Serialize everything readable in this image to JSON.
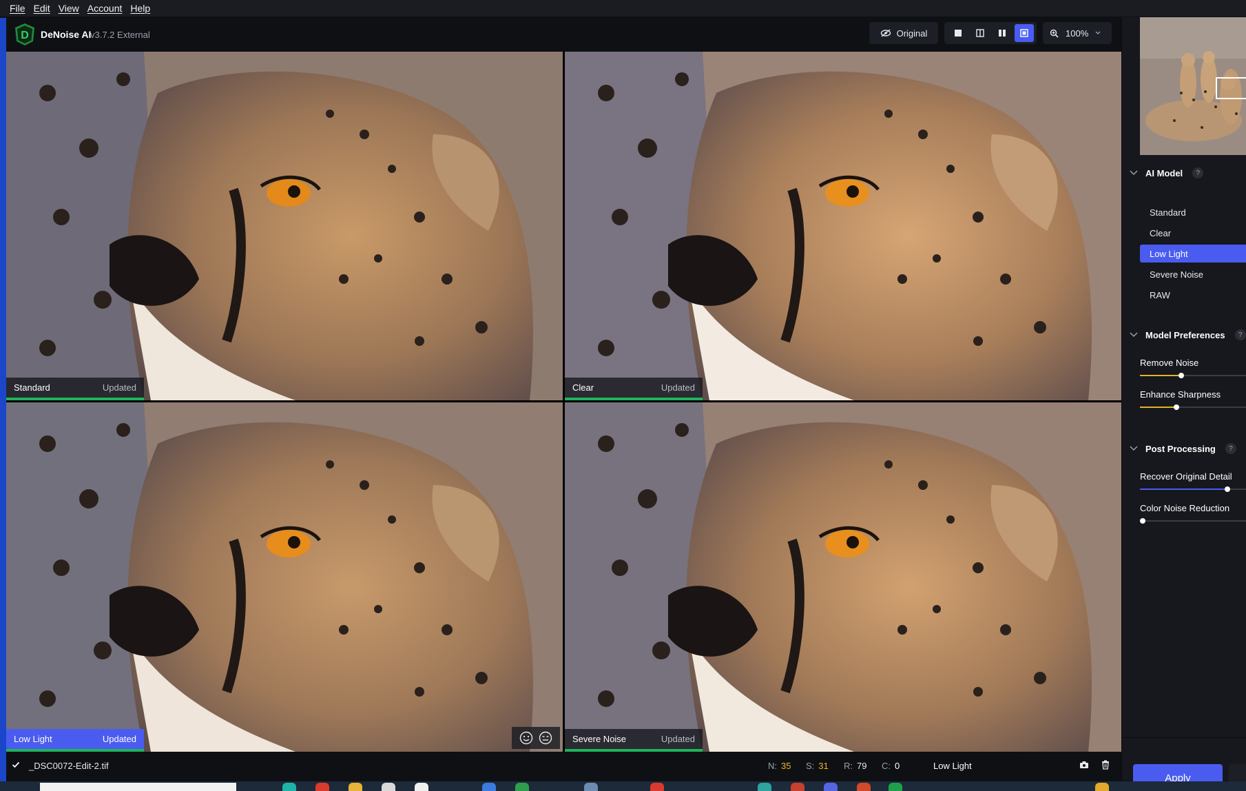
{
  "menu": {
    "file": "File",
    "edit": "Edit",
    "view": "View",
    "account": "Account",
    "help": "Help"
  },
  "header": {
    "app_name": "DeNoise AI",
    "version": "v3.7.2 External",
    "original_label": "Original",
    "zoom_value": "100%"
  },
  "panels": [
    {
      "name": "Standard",
      "status": "Updated"
    },
    {
      "name": "Clear",
      "status": "Updated"
    },
    {
      "name": "Low Light",
      "status": "Updated"
    },
    {
      "name": "Severe Noise",
      "status": "Updated"
    }
  ],
  "sidebar": {
    "ai_model_title": "AI Model",
    "help_mark": "?",
    "models": [
      "Standard",
      "Clear",
      "Low Light",
      "Severe Noise",
      "RAW"
    ],
    "selected_model": "Low Light",
    "model_prefs_title": "Model Preferences",
    "remove_noise_label": "Remove Noise",
    "remove_noise_value": 0.39,
    "enhance_sharpness_label": "Enhance Sharpness",
    "enhance_sharpness_value": 0.34,
    "post_processing_title": "Post Processing",
    "recover_detail_label": "Recover Original Detail",
    "recover_detail_value": 0.82,
    "color_noise_label": "Color Noise Reduction",
    "color_noise_value": 0.0,
    "apply_label": "Apply"
  },
  "status": {
    "filename": "_DSC0072-Edit-2.tif",
    "n_label": "N:",
    "n_value": "35",
    "s_label": "S:",
    "s_value": "31",
    "r_label": "R:",
    "r_value": "79",
    "c_label": "C:",
    "c_value": "0",
    "model": "Low Light"
  },
  "colors": {
    "accent": "#4a5cf0",
    "updated_bar": "#1fb45b",
    "slider_fill": "#e8b02a"
  }
}
